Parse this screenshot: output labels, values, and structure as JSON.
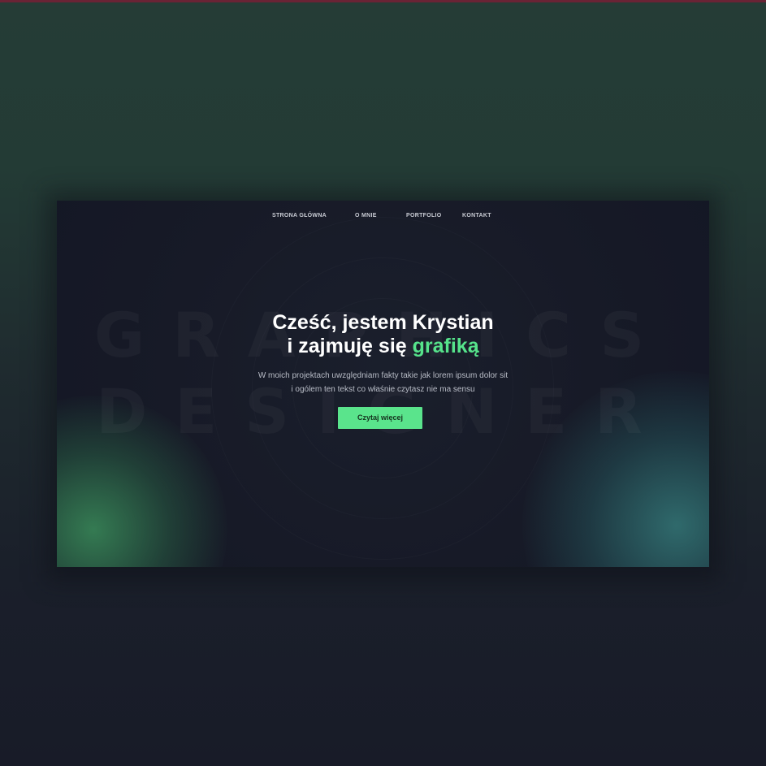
{
  "nav": {
    "items": [
      {
        "label": "STRONA GŁÓWNA"
      },
      {
        "label": "O MNIE"
      },
      {
        "label": "PORTFOLIO"
      },
      {
        "label": "KONTAKT"
      }
    ]
  },
  "hero": {
    "watermark_line1": "GRAPHICS",
    "watermark_line2": "DESIGNER",
    "title_line1": "Cześć, jestem Krystian",
    "title_line2_prefix": "i zajmuję się ",
    "title_line2_accent": "grafiką",
    "description_line1": "W moich projektach uwzględniam fakty takie jak lorem ipsum dolor sit",
    "description_line2": "i ogólem ten tekst co właśnie czytasz nie ma sensu",
    "cta_label": "Czytaj więcej"
  },
  "colors": {
    "accent": "#5ae48c",
    "background_top": "#233b35",
    "background_bottom": "#181b28",
    "hero_background": "#171a27"
  }
}
